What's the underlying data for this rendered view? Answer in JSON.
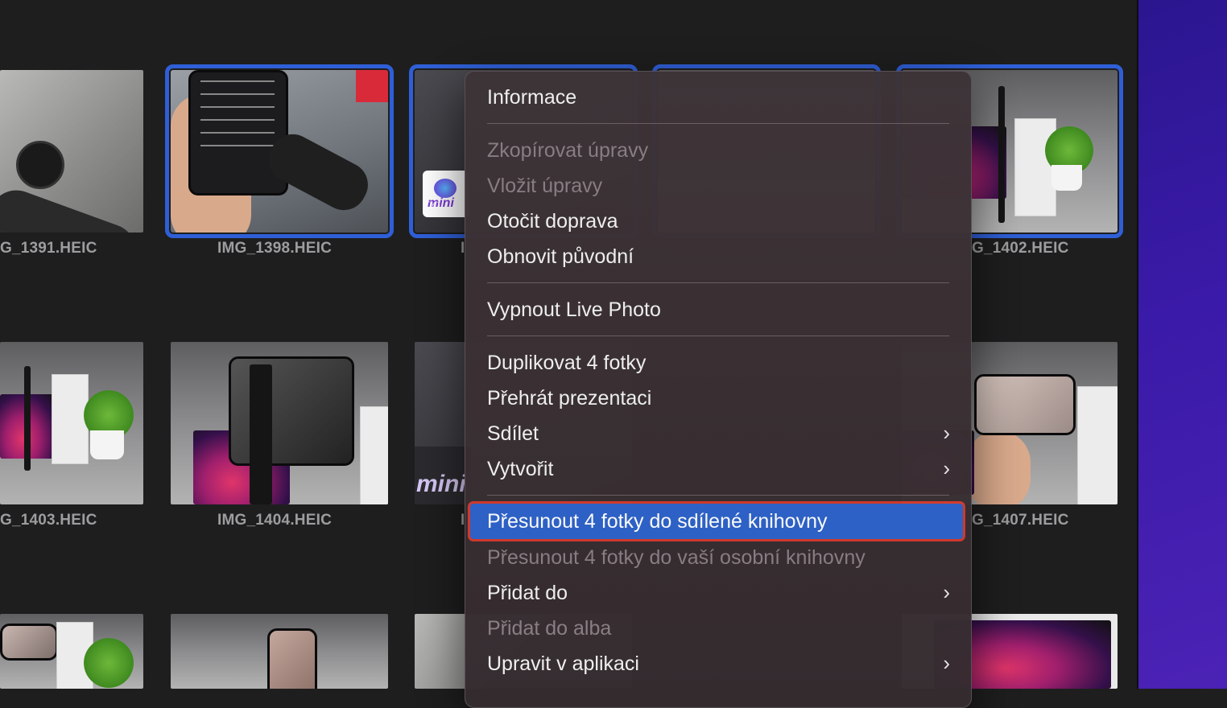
{
  "photos": [
    {
      "filename": "G_1391.HEIC",
      "selected": false
    },
    {
      "filename": "IMG_1398.HEIC",
      "selected": true
    },
    {
      "filename": "",
      "selected": true
    },
    {
      "filename": "",
      "selected": true
    },
    {
      "filename": "G_1402.HEIC",
      "selected": true
    },
    {
      "filename": "G_1403.HEIC",
      "selected": false
    },
    {
      "filename": "IMG_1404.HEIC",
      "selected": false
    },
    {
      "filename": "",
      "selected": false
    },
    {
      "filename": "G_1407.HEIC",
      "selected": false
    }
  ],
  "partial_caption_letter": "I",
  "thumb_text": {
    "cube_label": "mini",
    "favorite_icon": "heart-icon"
  },
  "context_menu": {
    "info": "Informace",
    "copy_edits": "Zkopírovat úpravy",
    "paste_edits": "Vložit úpravy",
    "rotate_right": "Otočit doprava",
    "revert": "Obnovit původní",
    "turn_off_live": "Vypnout Live Photo",
    "duplicate": "Duplikovat 4 fotky",
    "slideshow": "Přehrát prezentaci",
    "share": "Sdílet",
    "create": "Vytvořit",
    "move_shared": "Přesunout 4 fotky do sdílené knihovny",
    "move_personal": "Přesunout 4 fotky do vaší osobní knihovny",
    "add_to": "Přidat do",
    "add_to_album": "Přidat do alba",
    "edit_in_app": "Upravit v aplikaci"
  },
  "colors": {
    "selection": "#2f5fd6",
    "highlight": "#2f63c9",
    "annotation_box": "#d33a2c",
    "desktop": "#3a1aa8"
  }
}
